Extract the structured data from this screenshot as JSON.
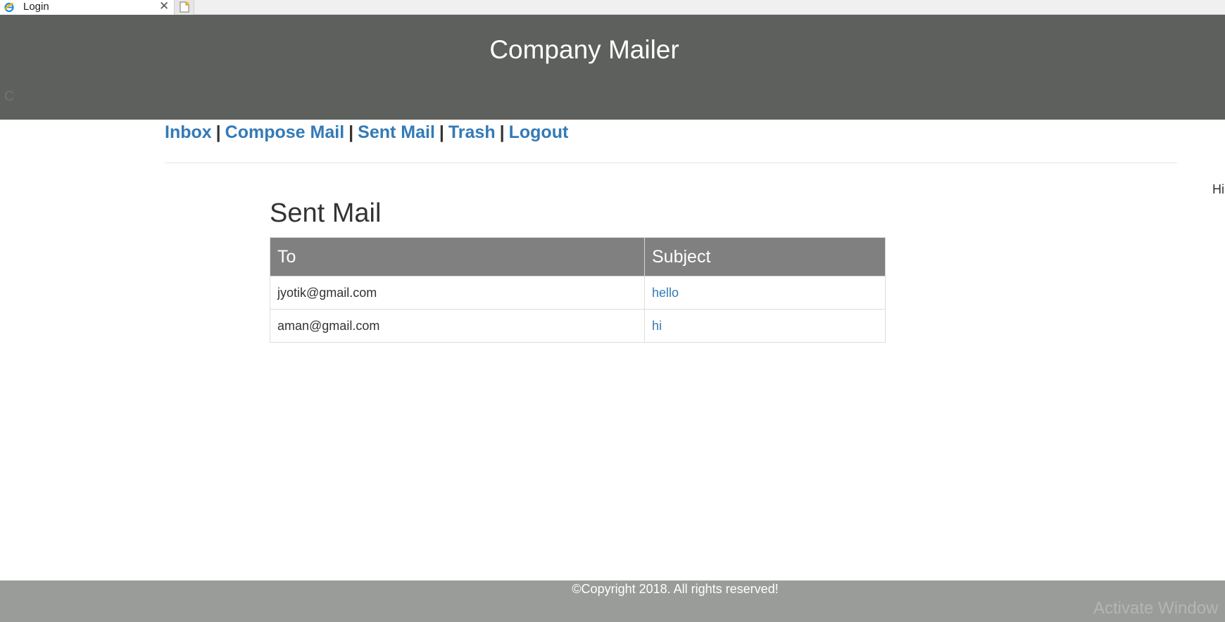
{
  "browser": {
    "tab_title": "Login",
    "tab_close": "✕",
    "favicon": "ie-icon",
    "new_tab_icon": "new-tab-icon"
  },
  "header": {
    "title": "Company Mailer",
    "stray_text": "C"
  },
  "nav": {
    "items": [
      {
        "label": "Inbox"
      },
      {
        "label": "Compose Mail"
      },
      {
        "label": "Sent Mail"
      },
      {
        "label": "Trash"
      },
      {
        "label": "Logout"
      }
    ],
    "separator": "|"
  },
  "greeting": "Hi",
  "main": {
    "heading": "Sent Mail",
    "table": {
      "columns": [
        "To",
        "Subject"
      ],
      "rows": [
        {
          "to": "jyotik@gmail.com",
          "subject": "hello"
        },
        {
          "to": "aman@gmail.com",
          "subject": "hi"
        }
      ]
    }
  },
  "footer": {
    "copyright": "©Copyright 2018. All rights reserved!",
    "watermark": "Activate Window"
  },
  "colors": {
    "header_bg": "#5e605d",
    "footer_bg": "#999c98",
    "table_header_bg": "#808080",
    "link": "#337ab7"
  }
}
